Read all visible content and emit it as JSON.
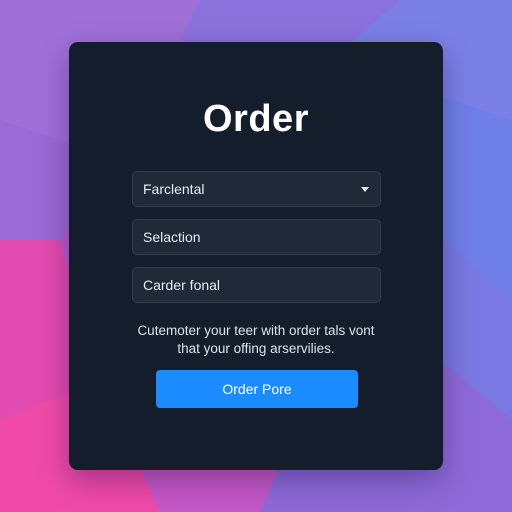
{
  "theme": {
    "card_color": "#131d2c",
    "field_color": "#1f2938",
    "button_color": "#1a8cff",
    "text_color": "#ffffff"
  },
  "form": {
    "title": "Order",
    "fields": [
      {
        "value": "Farclental",
        "type": "select",
        "icon": "chevron-down-icon"
      },
      {
        "value": "Selaction",
        "type": "text"
      },
      {
        "value": "Carder fonal",
        "type": "text"
      }
    ],
    "description_lines": [
      "Cutemoter your teer with order tals vont",
      "that your offing arservilies."
    ],
    "submit_label": "Order Pore"
  }
}
